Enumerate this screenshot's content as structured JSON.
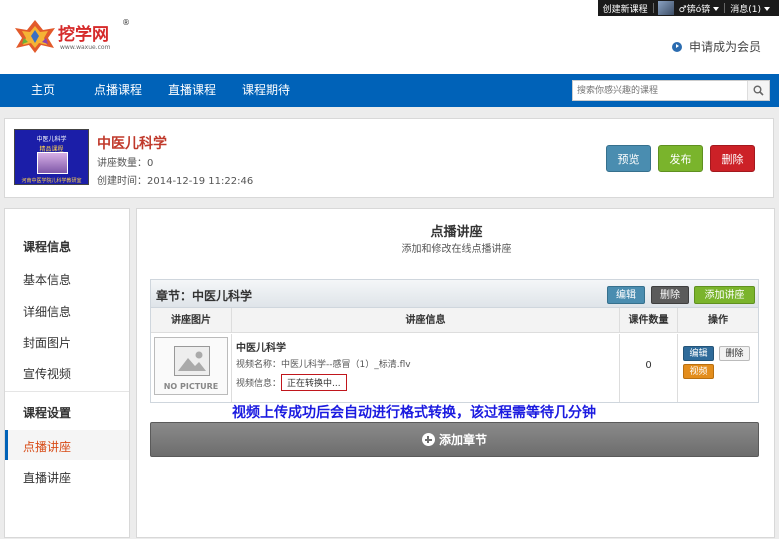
{
  "topbar": {
    "create_course": "创建新课程",
    "user": "♂锛ó锛",
    "messages": "消息(1)"
  },
  "header": {
    "logo_text": "挖学网",
    "logo_reg": "®",
    "logo_url": "www.waxue.com",
    "apply_member": "申请成为会员"
  },
  "nav": {
    "items": [
      "主页",
      "点播课程",
      "直播课程",
      "课程期待"
    ],
    "search_placeholder": "搜索你感兴趣的课程"
  },
  "course": {
    "cover_title": "中医儿科学",
    "cover_subtitle": "精品课程",
    "cover_footer": "河南中医学院儿科学教研室",
    "title": "中医儿科学",
    "lecture_count": "讲座数量：0",
    "created": "创建时间：2014-12-19 11:22:46",
    "buttons": {
      "preview": "预览",
      "publish": "发布",
      "delete": "删除"
    }
  },
  "sidebar": {
    "section1": "课程信息",
    "items1": [
      "基本信息",
      "详细信息",
      "封面图片",
      "宣传视频"
    ],
    "section2": "课程设置",
    "active": "点播讲座",
    "items2": [
      "直播讲座"
    ]
  },
  "main": {
    "title": "点播讲座",
    "subtitle": "添加和修改在线点播讲座",
    "chapter": {
      "title": "章节：中医儿科学",
      "edit": "编辑",
      "delete": "删除",
      "add_lecture": "添加讲座",
      "columns": [
        "讲座图片",
        "讲座信息",
        "课件数量",
        "操作"
      ],
      "row": {
        "no_picture": "NO PICTURE",
        "lecture_title": "中医儿科学",
        "video_name": "视频名称：中医儿科学--感冒（1）_标清.flv",
        "video_info_label": "视频信息：",
        "video_status": "正在转换中...",
        "count": "0",
        "actions": {
          "edit": "编辑",
          "delete": "删除",
          "video": "视频"
        }
      }
    },
    "note": "视频上传成功后会自动进行格式转换，该过程需等待几分钟",
    "add_chapter": "添加章节"
  }
}
